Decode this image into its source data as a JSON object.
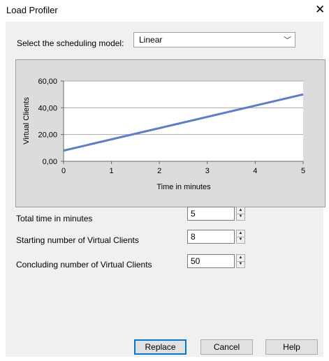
{
  "window": {
    "title": "Load Profiler",
    "close_glyph": "✕"
  },
  "scheduling": {
    "label": "Select the scheduling model:",
    "selected": "Linear"
  },
  "chart_data": {
    "type": "line",
    "xlabel": "Time in minutes",
    "ylabel": "Virtual Clients",
    "x_ticks": [
      "0",
      "1",
      "2",
      "3",
      "4",
      "5"
    ],
    "y_ticks": [
      "0,00",
      "20,00",
      "40,00",
      "60,00"
    ],
    "xlim": [
      0,
      5
    ],
    "ylim": [
      0,
      60
    ],
    "grid": true,
    "series": [
      {
        "x": [
          0,
          5
        ],
        "values": [
          8,
          50
        ],
        "color": "#5b7bd5"
      }
    ]
  },
  "fields": [
    {
      "label": "Total time in minutes",
      "value": "5"
    },
    {
      "label": "Starting number of Virtual Clients",
      "value": "8"
    },
    {
      "label": "Concluding number of Virtual Clients",
      "value": "50"
    }
  ],
  "buttons": {
    "replace": "Replace",
    "cancel": "Cancel",
    "help": "Help"
  },
  "icons": {
    "dropdown": "chevron-down-icon",
    "spin_up": "triangle-up-icon",
    "spin_down": "triangle-down-icon"
  }
}
